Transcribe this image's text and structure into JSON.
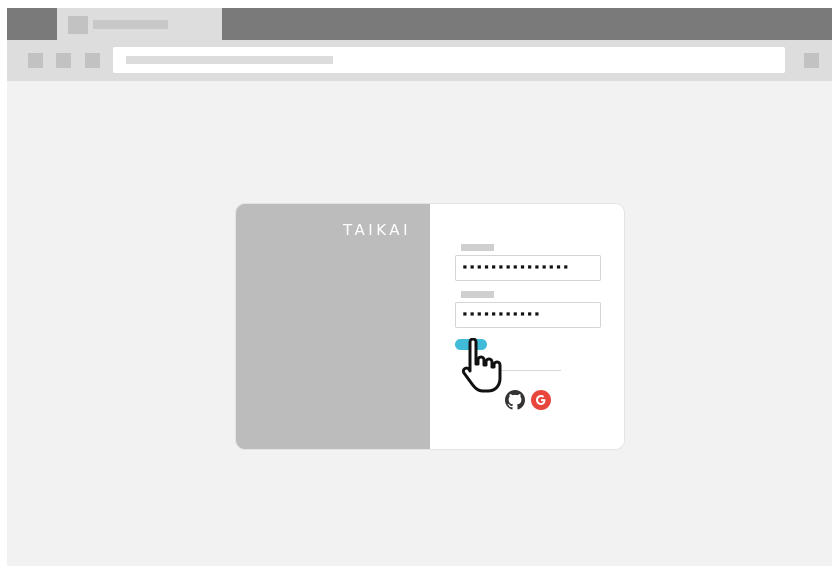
{
  "browser": {
    "tab": {
      "favicon_icon": "placeholder-square",
      "title_placeholder": "skeleton-bar"
    },
    "toolbar": {
      "nav_buttons": [
        "back-icon",
        "forward-icon",
        "reload-icon"
      ],
      "address_placeholder": "skeleton-bar",
      "menu_icon": "menu-icon"
    }
  },
  "login_card": {
    "brand": "TAIKAI",
    "username_field": {
      "label": "skeleton-bar",
      "value": "▪▪▪▪▪▪▪▪▪▪▪▪▪▪▪"
    },
    "password_field": {
      "label": "skeleton-bar",
      "value": "▪▪▪▪▪▪▪▪▪▪▪"
    },
    "submit_button": {
      "color": "#40bcd8"
    },
    "social_login": [
      {
        "name": "github",
        "icon": "github-icon",
        "color": "#333333"
      },
      {
        "name": "google",
        "icon": "google-icon",
        "color": "#e8453c"
      }
    ]
  },
  "cursor": {
    "icon": "hand-pointer-cursor"
  },
  "colors": {
    "tabstrip": "#7a7a7a",
    "toolbar": "#dddddd",
    "page_bg": "#f2f2f2",
    "card_left_panel": "#bcbcbc",
    "accent": "#40bcd8"
  }
}
